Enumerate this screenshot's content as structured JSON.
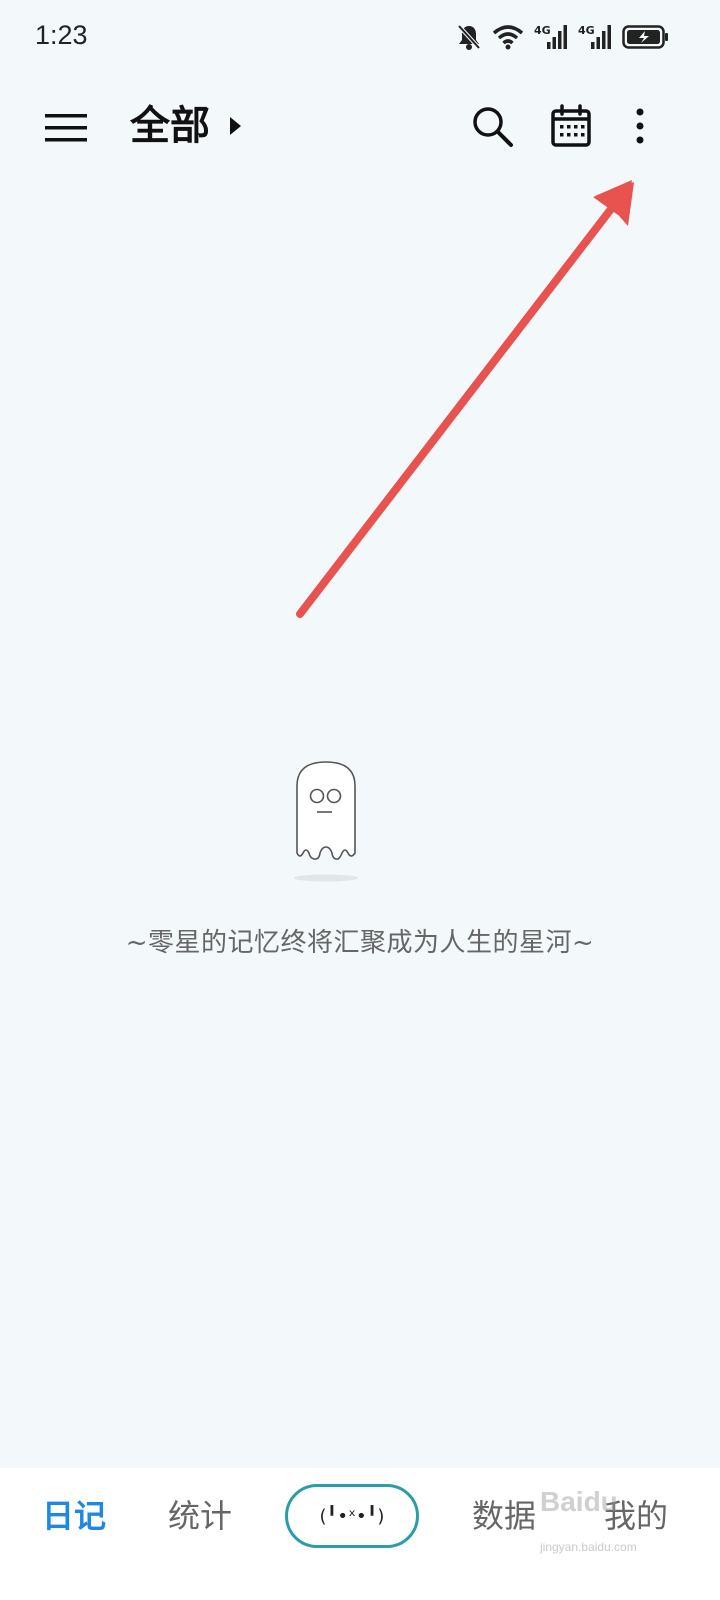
{
  "status_bar": {
    "time": "1:23",
    "icons": [
      "bell-muted-icon",
      "wifi-icon",
      "signal-4g-icon",
      "signal-4g-icon",
      "battery-icon"
    ],
    "network_label_1": "4G",
    "network_label_2": "4G"
  },
  "app_bar": {
    "title": "全部",
    "icons": [
      "menu-icon",
      "search-icon",
      "calendar-icon",
      "more-vertical-icon"
    ]
  },
  "empty_state": {
    "icon": "ghost-icon",
    "message": "~零星的记忆终将汇聚成为人生的星河~"
  },
  "bottom_nav": {
    "items": [
      {
        "label": "日记",
        "active": true
      },
      {
        "label": "统计",
        "active": false
      },
      {
        "label": "数据",
        "active": false
      },
      {
        "label": "我的",
        "active": false
      }
    ],
    "center_button_face": "(╹•ˣ•╹)"
  },
  "watermark": {
    "text": "Baidu",
    "subtext": "jingyan.baidu.com"
  },
  "colors": {
    "background": "#F3F8FB",
    "accent": "#1E88E5",
    "annotation": "#E8534F",
    "center_button_border": "#2A9DA8"
  }
}
